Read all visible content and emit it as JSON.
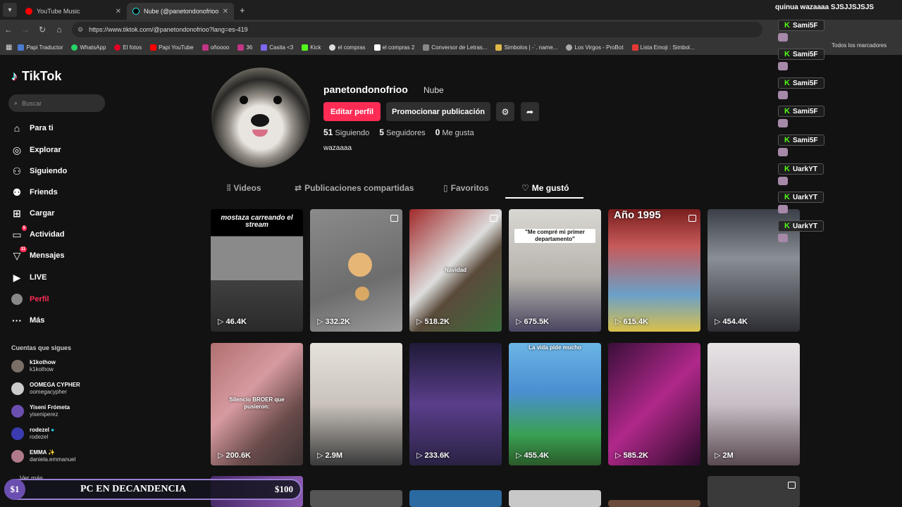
{
  "browser": {
    "tabs": [
      {
        "title": "YouTube Music",
        "color": "#ff0000"
      },
      {
        "title": "Nube (@panetondonofrioo) | T",
        "color": "#111111"
      }
    ],
    "url": "https://www.tiktok.com/@panetondonofrioo?lang=es-419",
    "bookmarks": [
      "Papi Traductor",
      "WhatsApp",
      "El fotos",
      "Papi YouTube",
      "oñoooo",
      "36",
      "Casita <3",
      "Kick",
      "el compras",
      "el compras 2",
      "Conversor de Letras...",
      "Simbolos | -`. name...",
      "Los Virgos - ProBot",
      "Lista Emoji : Simbol..."
    ],
    "bookmarks_all": "Todos los marcadores"
  },
  "sidebar": {
    "brand": "TikTok",
    "search_placeholder": "Buscar",
    "items": [
      {
        "label": "Para ti",
        "icon": "home-icon"
      },
      {
        "label": "Explorar",
        "icon": "compass-icon"
      },
      {
        "label": "Siguiendo",
        "icon": "user-follow-icon"
      },
      {
        "label": "Friends",
        "icon": "friends-icon"
      },
      {
        "label": "Cargar",
        "icon": "upload-icon"
      },
      {
        "label": "Actividad",
        "icon": "activity-icon",
        "badge": "5"
      },
      {
        "label": "Mensajes",
        "icon": "messages-icon",
        "badge": "11"
      },
      {
        "label": "LIVE",
        "icon": "live-icon"
      },
      {
        "label": "Perfil",
        "icon": "profile-icon"
      },
      {
        "label": "Más",
        "icon": "more-icon"
      }
    ],
    "following_title": "Cuentas que sigues",
    "accounts": [
      {
        "name": "k1kothow",
        "handle": "k1kothow"
      },
      {
        "name": "OOMEGA CYPHER",
        "handle": "oomegacypher"
      },
      {
        "name": "Yiseni Frómeta",
        "handle": "yiseniperez"
      },
      {
        "name": "rodezel",
        "handle": "rodezel"
      },
      {
        "name": "EMMA ✨",
        "handle": "daniela.emmanuel"
      }
    ],
    "more_label": "Ver más"
  },
  "profile": {
    "username": "panetondonofrioo",
    "nickname": "Nube",
    "edit_label": "Editar perfil",
    "promote_label": "Promocionar publicación",
    "following_count": "51",
    "following_label": "Siguiendo",
    "followers_count": "5",
    "followers_label": "Seguidores",
    "likes_count": "0",
    "likes_label": "Me gusta",
    "bio": "wazaaaa"
  },
  "profile_tabs": [
    "Videos",
    "Publicaciones compartidas",
    "Favoritos",
    "Me gustó"
  ],
  "videos": [
    {
      "views": "46.4K",
      "caption": "mostaza carreando el stream"
    },
    {
      "views": "332.2K",
      "caption": ""
    },
    {
      "views": "518.2K",
      "caption": "Navidad"
    },
    {
      "views": "675.5K",
      "caption": "\"Me compré mi primer departamento\""
    },
    {
      "views": "615.4K",
      "caption": "Año 1995"
    },
    {
      "views": "454.4K",
      "caption": ""
    },
    {
      "views": "200.6K",
      "caption": "Silencio BROER que pusieron:"
    },
    {
      "views": "2.9M",
      "caption": ""
    },
    {
      "views": "233.6K",
      "caption": ""
    },
    {
      "views": "455.4K",
      "caption": "La vida pide mucho"
    },
    {
      "views": "585.2K",
      "caption": ""
    },
    {
      "views": "2M",
      "caption": ""
    }
  ],
  "chat": {
    "top_line": "quinua wazaaaa SJSJJSJSJS",
    "messages": [
      "Sami5F",
      "Sami5F",
      "Sami5F",
      "Sami5F",
      "Sami5F",
      "UarkYT",
      "UarkYT",
      "UarkYT"
    ]
  },
  "banner": {
    "left": "$1",
    "text": "PC EN DECANDENCIA",
    "right": "$100"
  },
  "colors": {
    "accent": "#fe2c55",
    "kick_green": "#53fc18"
  }
}
